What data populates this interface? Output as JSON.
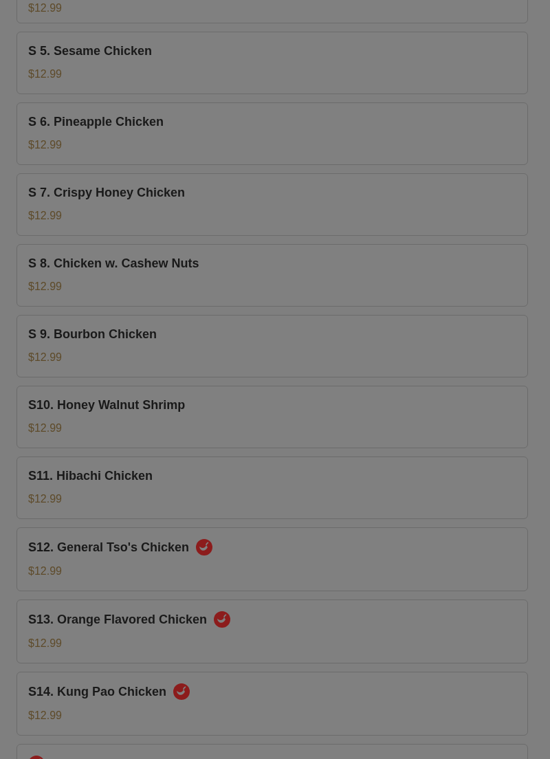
{
  "menu_items": [
    {
      "price": "$12.99",
      "spicy": false
    },
    {
      "title": "S 5. Sesame Chicken",
      "price": "$12.99",
      "spicy": false
    },
    {
      "title": "S 6. Pineapple Chicken",
      "price": "$12.99",
      "spicy": false
    },
    {
      "title": "S 7. Crispy Honey Chicken",
      "price": "$12.99",
      "spicy": false
    },
    {
      "title": "S 8. Chicken w. Cashew Nuts",
      "price": "$12.99",
      "spicy": false
    },
    {
      "title": "S 9. Bourbon Chicken",
      "price": "$12.99",
      "spicy": false
    },
    {
      "title": "S10. Honey Walnut Shrimp",
      "price": "$12.99",
      "spicy": false
    },
    {
      "title": "S11. Hibachi Chicken",
      "price": "$12.99",
      "spicy": false
    },
    {
      "title": "S12. General Tso's Chicken",
      "price": "$12.99",
      "spicy": true
    },
    {
      "title": "S13. Orange Flavored Chicken",
      "price": "$12.99",
      "spicy": true
    },
    {
      "title": "S14. Kung Pao Chicken",
      "price": "$12.99",
      "spicy": true
    },
    {
      "spicy": true
    }
  ]
}
